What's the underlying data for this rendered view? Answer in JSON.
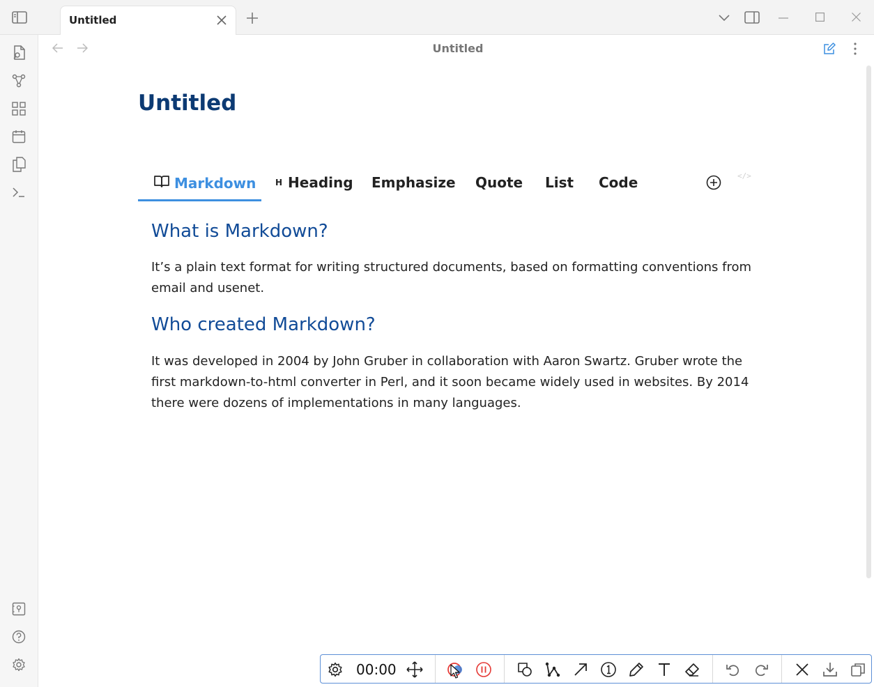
{
  "window": {
    "tab_title": "Untitled",
    "view_title": "Untitled",
    "icons": {
      "sidebar_toggle": "sidebar-left-icon",
      "new_tab": "plus-icon",
      "tab_list": "chevron-down-icon",
      "right_sidebar": "sidebar-right-icon",
      "minimize": "minimize-icon",
      "maximize": "maximize-icon",
      "close": "close-icon"
    }
  },
  "ribbon": {
    "top_icons": [
      "file-search-icon",
      "graph-icon",
      "blocks-icon",
      "calendar-icon",
      "copy-icon",
      "terminal-icon"
    ],
    "bottom_icons": [
      "vault-icon",
      "help-icon",
      "settings-icon"
    ]
  },
  "document": {
    "title": "Untitled",
    "tabs": [
      {
        "label": "Markdown",
        "icon": "book-open-icon",
        "active": true
      },
      {
        "label": "Heading",
        "prefix": "H",
        "active": false
      },
      {
        "label": "Emphasize",
        "active": false
      },
      {
        "label": "Quote",
        "active": false
      },
      {
        "label": "List",
        "active": false
      },
      {
        "label": "Code",
        "active": false
      }
    ],
    "tab_actions": {
      "add": "plus-circle-icon",
      "code_toggle": "</>"
    },
    "sections": [
      {
        "heading": "What is Markdown?",
        "body": "It’s a plain text format for writing structured documents, based on formatting conventions from email and usenet."
      },
      {
        "heading": "Who created Markdown?",
        "body": "It was developed in 2004 by John Gruber in collaboration with Aaron Swartz. Gruber wrote the first markdown-to-html converter in Perl, and it soon became widely used in websites. By 2014 there were dozens of implementations in many languages."
      }
    ]
  },
  "recorder": {
    "timer": "00:00",
    "colors": {
      "record": "#e53935",
      "accent": "#3d7fd6"
    }
  }
}
